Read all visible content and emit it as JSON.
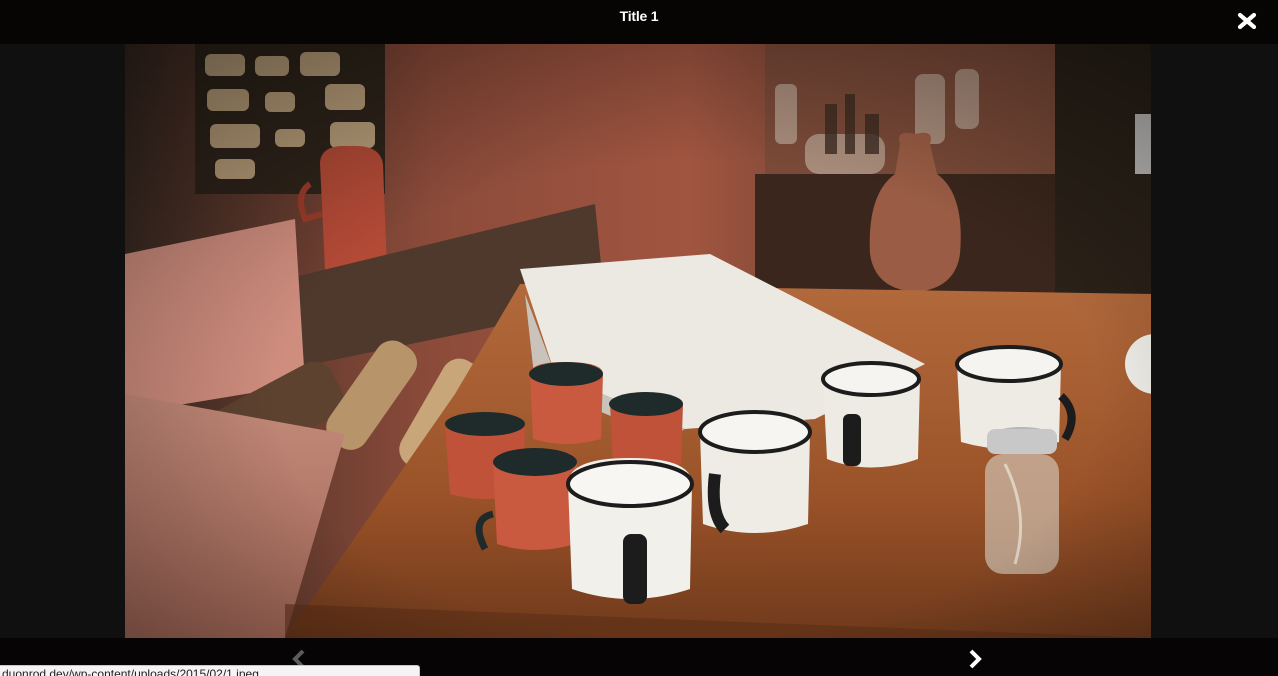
{
  "header": {
    "title": "Title 1"
  },
  "image": {
    "icon": "photo-image",
    "description_hidden": ""
  },
  "navigation": {
    "prev_icon": "chevron-left-icon",
    "next_icon": "chevron-right-icon",
    "close_icon": "close-icon",
    "prev_enabled": false
  },
  "status_bar": {
    "url": "duonrod.dev/wp-content/uploads/2015/02/1.jpeg"
  },
  "colors": {
    "overlay": "#101010",
    "bar": "#070504",
    "icon": "#ffffff"
  }
}
